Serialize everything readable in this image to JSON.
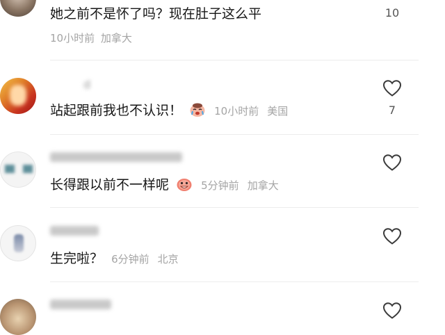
{
  "comments": [
    {
      "username": "",
      "text": "她之前不是怀了吗？现在肚子这么平",
      "time": "10小时前",
      "location": "加拿大",
      "likes": "10"
    },
    {
      "username": "　　　d",
      "text": "站起跟前我也不认识！",
      "emoji": "crying-face-sticker",
      "time": "10小时前",
      "location": "美国",
      "likes": "7"
    },
    {
      "username": "",
      "text": "长得跟以前不一样呢",
      "emoji": "laughing-face-sticker",
      "time": "5分钟前",
      "location": "加拿大",
      "likes": ""
    },
    {
      "username": "",
      "text": "生完啦？",
      "time": "6分钟前",
      "location": "北京",
      "likes": ""
    },
    {
      "username": "",
      "text": "",
      "time": "",
      "location": "",
      "likes": ""
    }
  ],
  "colors": {
    "text": "#161616",
    "meta": "#a4a4a4",
    "divider": "#ececec",
    "heart_outline": "#3a3a3a"
  },
  "icons": {
    "like": "heart-outline-icon"
  }
}
